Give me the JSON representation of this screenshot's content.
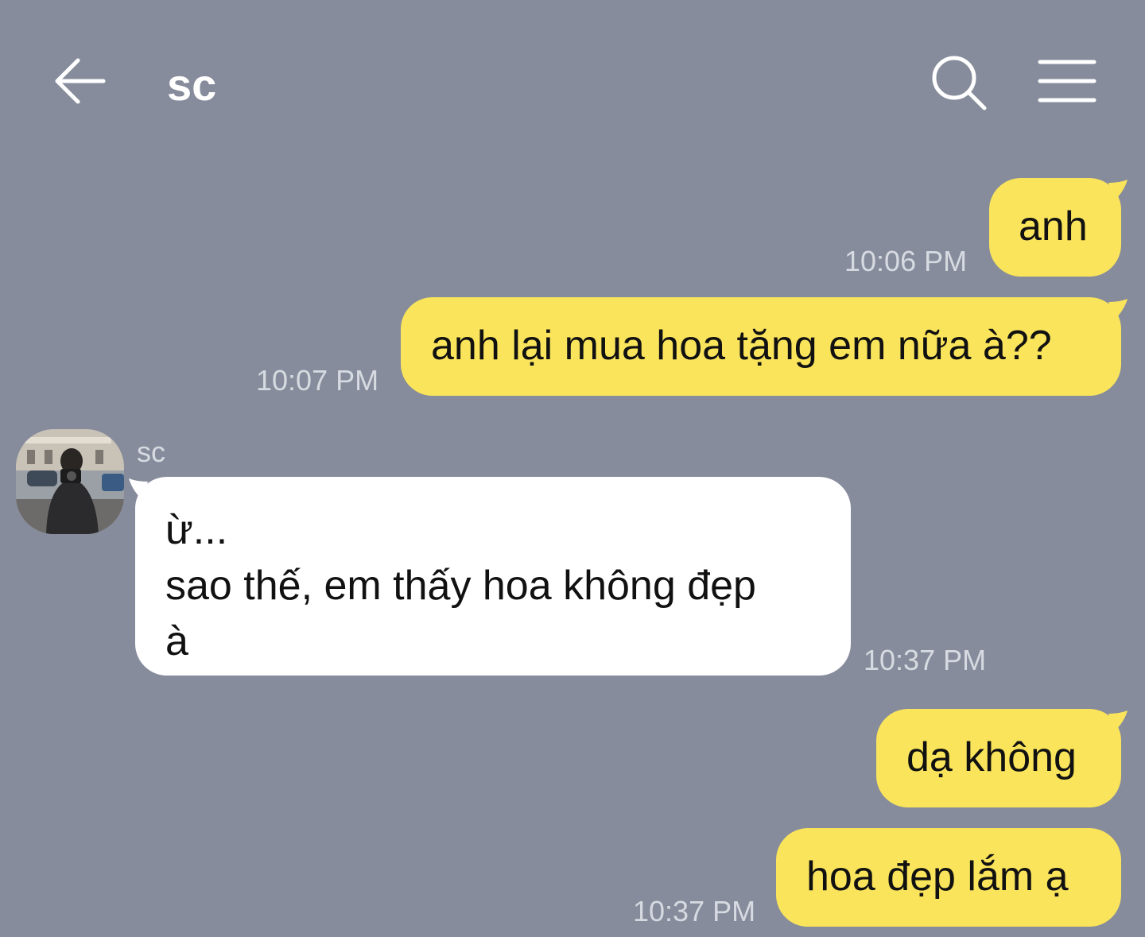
{
  "header": {
    "title": "sc",
    "back_icon": "arrow-left-icon",
    "search_icon": "search-icon",
    "menu_icon": "hamburger-menu-icon"
  },
  "colors": {
    "background": "#868c9b",
    "my_bubble": "#fae45b",
    "their_bubble": "#ffffff",
    "timestamp": "#d7dae1"
  },
  "messages": [
    {
      "from": "me",
      "text": "anh",
      "time": "10:06 PM"
    },
    {
      "from": "me",
      "text": "anh lại mua hoa tặng em nữa à??",
      "time": "10:07 PM"
    },
    {
      "from": "them",
      "sender": "sc",
      "text": "ừ...\nsao thế, em thấy hoa không đẹp\nà",
      "time": "10:37 PM"
    },
    {
      "from": "me",
      "text": "dạ không",
      "time": ""
    },
    {
      "from": "me",
      "text": "hoa đẹp lắm ạ",
      "time": "10:37 PM"
    }
  ]
}
